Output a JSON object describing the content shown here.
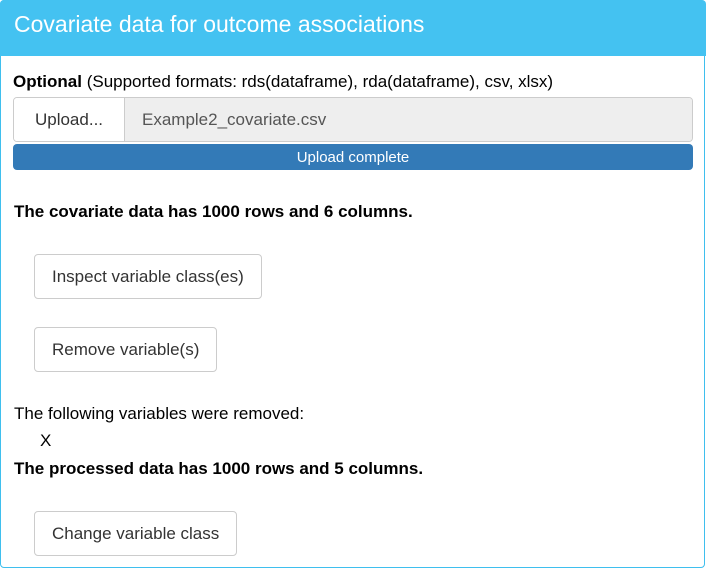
{
  "panel": {
    "title": "Covariate data for outcome associations"
  },
  "upload": {
    "optional_label": "Optional",
    "formats_text": "(Supported formats: rds(dataframe), rda(dataframe), csv, xlsx)",
    "button_label": "Upload...",
    "file_name": "Example2_covariate.csv",
    "progress_label": "Upload complete",
    "progress_fraction": 1.0
  },
  "summary": {
    "covariate_text": "The covariate data has 1000 rows and 6 columns."
  },
  "actions": {
    "inspect_label": "Inspect variable class(es)",
    "remove_label": "Remove variable(s)",
    "change_label": "Change variable class"
  },
  "removed": {
    "heading": "The following variables were removed:",
    "variables": [
      "X"
    ]
  },
  "processed": {
    "text": "The processed data has 1000 rows and 5 columns."
  },
  "colors": {
    "header_bg": "#44c2f1",
    "progress_bar": "#337ab7"
  }
}
